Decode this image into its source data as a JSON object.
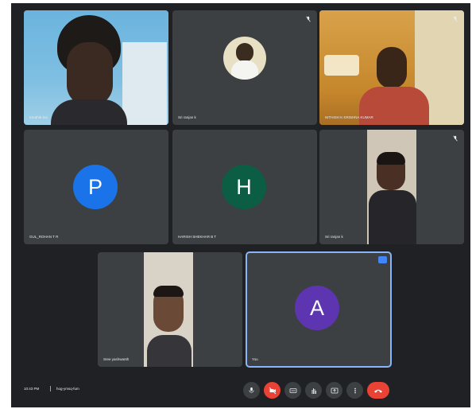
{
  "tiles": [
    {
      "name": "Kiruthik Sai",
      "label": "camera feed"
    },
    {
      "name": "Sri ranjan k",
      "label": "avatar photo"
    },
    {
      "name": "NITHISH K KRISHNA KUMAR",
      "label": "camera feed"
    },
    {
      "name": "GUL_ROHAN T R",
      "initial": "P",
      "color": "#1a73e8"
    },
    {
      "name": "HARISH SHEKHAR B T",
      "initial": "H",
      "color": "#0b5d43"
    },
    {
      "name": "Sri ranjan k",
      "label": "camera feed"
    },
    {
      "name": "Sree yashwanth",
      "label": "camera feed"
    },
    {
      "name": "You",
      "initial": "A",
      "color": "#5e35b1"
    }
  ],
  "bottom_bar": {
    "time": "10:43 PM",
    "meeting_code": "hog-ymsq-fum"
  },
  "controls": [
    {
      "icon": "mic-icon",
      "active": false
    },
    {
      "icon": "camera-off-icon",
      "active": true
    },
    {
      "icon": "captions-icon",
      "active": false
    },
    {
      "icon": "raise-hand-icon",
      "active": false
    },
    {
      "icon": "present-icon",
      "active": false
    },
    {
      "icon": "more-options-icon",
      "active": false
    },
    {
      "icon": "end-call-icon",
      "active": true
    }
  ],
  "colors": {
    "background": "#202124",
    "tile": "#3c4043",
    "accent": "#8ab4f8",
    "danger": "#ea4335"
  }
}
